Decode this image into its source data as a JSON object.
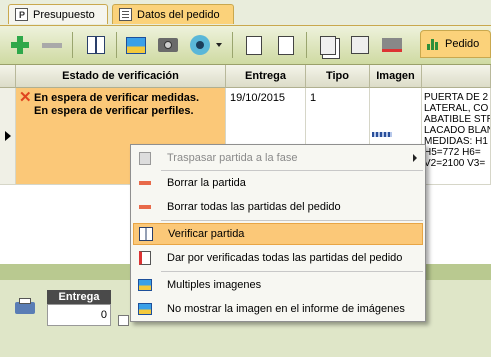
{
  "tabs": {
    "presupuesto": "Presupuesto",
    "datos_pedido": "Datos del pedido",
    "pedido": "Pedido"
  },
  "grid": {
    "columns": [
      "Estado de verificación",
      "Entrega",
      "Tipo",
      "Imagen"
    ],
    "row": {
      "estado_line1": "En espera de verificar medidas.",
      "estado_line2": "En espera de verificar perfiles.",
      "entrega": "19/10/2015",
      "tipo": "1",
      "descripcion_lines": [
        "PUERTA DE 2",
        "LATERAL, CO",
        "ABATIBLE STR",
        "LACADO BLAN",
        "MEDIDAS: H1",
        "H5=772 H6=",
        "V2=2100 V3="
      ]
    }
  },
  "bottom": {
    "entrega_label": "Entrega",
    "entrega_value": "0"
  },
  "context_menu": {
    "items": [
      {
        "label": "Traspasar partida a la fase",
        "enabled": false,
        "submenu": true
      },
      {
        "label": "Borrar la partida",
        "enabled": true
      },
      {
        "label": "Borrar todas las partidas del pedido",
        "enabled": true
      },
      {
        "label": "Verificar partida",
        "enabled": true,
        "highlighted": true
      },
      {
        "label": "Dar por verificadas todas las partidas del pedido",
        "enabled": true
      },
      {
        "label": "Multiples imagenes",
        "enabled": true
      },
      {
        "label": "No mostrar la imagen en el informe de imágenes",
        "enabled": true
      }
    ]
  },
  "colors": {
    "highlight": "#fbc878",
    "row_selected": "#fbc878",
    "accent_tab": "#fbd27a",
    "toolbar": "#cfdaa2"
  }
}
